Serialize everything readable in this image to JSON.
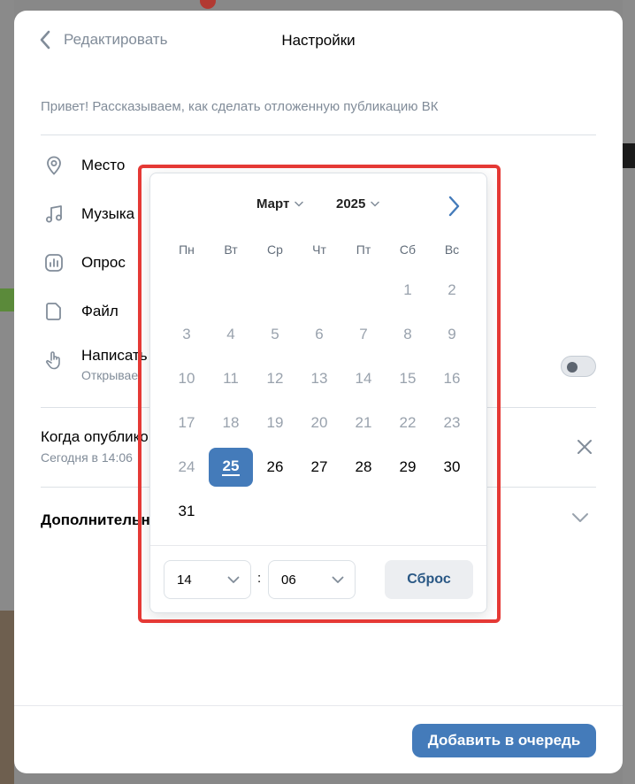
{
  "header": {
    "back_label": "Редактировать",
    "title": "Настройки"
  },
  "intro_text": "Привет! Рассказываем, как сделать отложенную публикацию ВК",
  "attachments": [
    {
      "label": "Место",
      "icon": "location-pin-icon"
    },
    {
      "label": "Музыка",
      "icon": "music-note-icon"
    },
    {
      "label": "Опрос",
      "icon": "poll-icon"
    },
    {
      "label": "Файл",
      "icon": "file-icon"
    }
  ],
  "write_row": {
    "label": "Написать",
    "sub": "Открывае",
    "icon": "hand-pointer-icon",
    "toggle_on": false
  },
  "schedule": {
    "title": "Когда опублико",
    "subtitle": "Сегодня в 14:06"
  },
  "extra_label": "Дополнительно",
  "add_button": "Добавить в очередь",
  "calendar": {
    "month": "Март",
    "year": "2025",
    "weekdays": [
      "Пн",
      "Вт",
      "Ср",
      "Чт",
      "Пт",
      "Сб",
      "Вс"
    ],
    "weeks": [
      [
        "",
        "",
        "",
        "",
        "",
        "1",
        "2"
      ],
      [
        "3",
        "4",
        "5",
        "6",
        "7",
        "8",
        "9"
      ],
      [
        "10",
        "11",
        "12",
        "13",
        "14",
        "15",
        "16"
      ],
      [
        "17",
        "18",
        "19",
        "20",
        "21",
        "22",
        "23"
      ],
      [
        "24",
        "25",
        "26",
        "27",
        "28",
        "29",
        "30"
      ],
      [
        "31",
        "",
        "",
        "",
        "",
        "",
        ""
      ]
    ],
    "selected_day": "25",
    "first_enabled_day": 25,
    "hour": "14",
    "minute": "06",
    "time_separator": ":",
    "reset_label": "Сброс"
  },
  "colors": {
    "accent": "#447bba",
    "highlight_frame": "#e53935",
    "muted_text": "#818c99"
  }
}
